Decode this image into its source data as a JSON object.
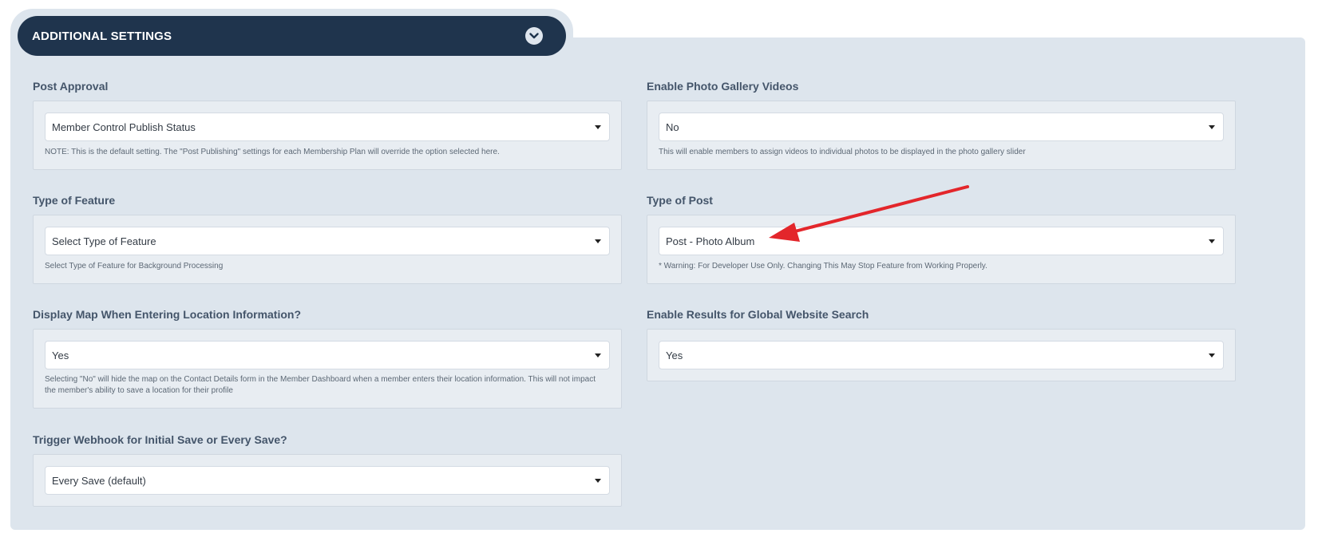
{
  "header": {
    "title": "ADDITIONAL SETTINGS",
    "toggle_icon": "chevron-down-icon"
  },
  "fields": {
    "post_approval": {
      "label": "Post Approval",
      "value": "Member Control Publish Status",
      "note": "NOTE: This is the default setting. The \"Post Publishing\" settings for each Membership Plan will override the option selected here."
    },
    "photo_gallery_videos": {
      "label": "Enable Photo Gallery Videos",
      "value": "No",
      "note": "This will enable members to assign videos to individual photos to be displayed in the photo gallery slider"
    },
    "type_of_feature": {
      "label": "Type of Feature",
      "value": "Select Type of Feature",
      "note": "Select Type of Feature for Background Processing"
    },
    "type_of_post": {
      "label": "Type of Post",
      "value": "Post - Photo Album",
      "note": "* Warning: For Developer Use Only. Changing This May Stop Feature from Working Properly."
    },
    "display_map": {
      "label": "Display Map When Entering Location Information?",
      "value": "Yes",
      "note": "Selecting \"No\" will hide the map on the Contact Details form in the Member Dashboard when a member enters their location information. This will not impact the member's ability to save a location for their profile"
    },
    "global_search": {
      "label": "Enable Results for Global Website Search",
      "value": "Yes"
    },
    "webhook": {
      "label": "Trigger Webhook for Initial Save or Every Save?",
      "value": "Every Save (default)"
    }
  },
  "annotation": {
    "arrow_color": "#e3262b"
  }
}
